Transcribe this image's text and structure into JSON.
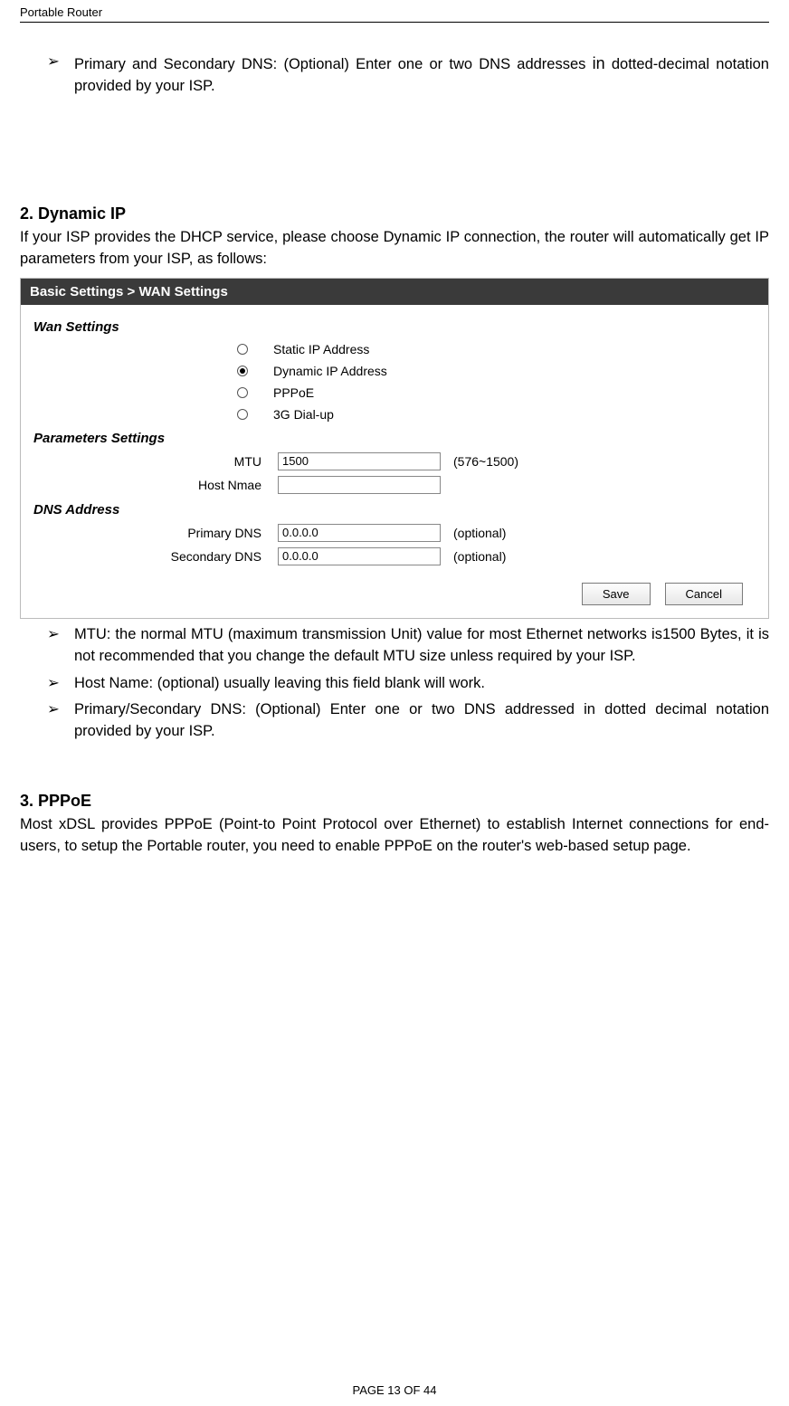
{
  "header": {
    "title": "Portable Router"
  },
  "top_bullet": {
    "prefix": "Primary and Secondary DNS: (Optional) Enter one or two DNS addresses ",
    "in": "in",
    "tail": "dotted-decimal notation provided by your ISP."
  },
  "section2": {
    "heading": "2.    Dynamic IP",
    "body": "If your ISP provides the DHCP service, please choose Dynamic IP connection, the router will automatically get IP parameters from your ISP, as follows:"
  },
  "panel": {
    "title": "Basic Settings > WAN Settings",
    "group_wan": "Wan Settings",
    "radios": [
      {
        "label": "Static IP Address",
        "selected": false
      },
      {
        "label": "Dynamic IP Address",
        "selected": true
      },
      {
        "label": "PPPoE",
        "selected": false
      },
      {
        "label": "3G Dial-up",
        "selected": false
      }
    ],
    "group_params": "Parameters Settings",
    "mtu_label": "MTU",
    "mtu_value": "1500",
    "mtu_hint": "(576~1500)",
    "host_label": "Host Nmae",
    "host_value": "",
    "group_dns": "DNS Address",
    "pdns_label": "Primary DNS",
    "pdns_value": "0.0.0.0",
    "pdns_hint": "(optional)",
    "sdns_label": "Secondary DNS",
    "sdns_value": "0.0.0.0",
    "sdns_hint": "(optional)",
    "save": "Save",
    "cancel": "Cancel"
  },
  "mid_bullets": [
    "MTU: the normal MTU (maximum transmission Unit) value for most Ethernet networks is1500 Bytes, it is not recommended that you change the default MTU size unless required by your ISP.",
    "Host Name: (optional) usually leaving this field blank will work.",
    "Primary/Secondary DNS: (Optional) Enter one or two DNS addressed in dotted decimal notation provided by your ISP."
  ],
  "section3": {
    "heading": "3.    PPPoE",
    "body": "Most xDSL provides PPPoE (Point-to Point Protocol over Ethernet) to establish Internet connections for end-users, to setup the Portable router, you need to enable PPPoE on the router's web-based setup page."
  },
  "footer": "PAGE    13    OF    44"
}
